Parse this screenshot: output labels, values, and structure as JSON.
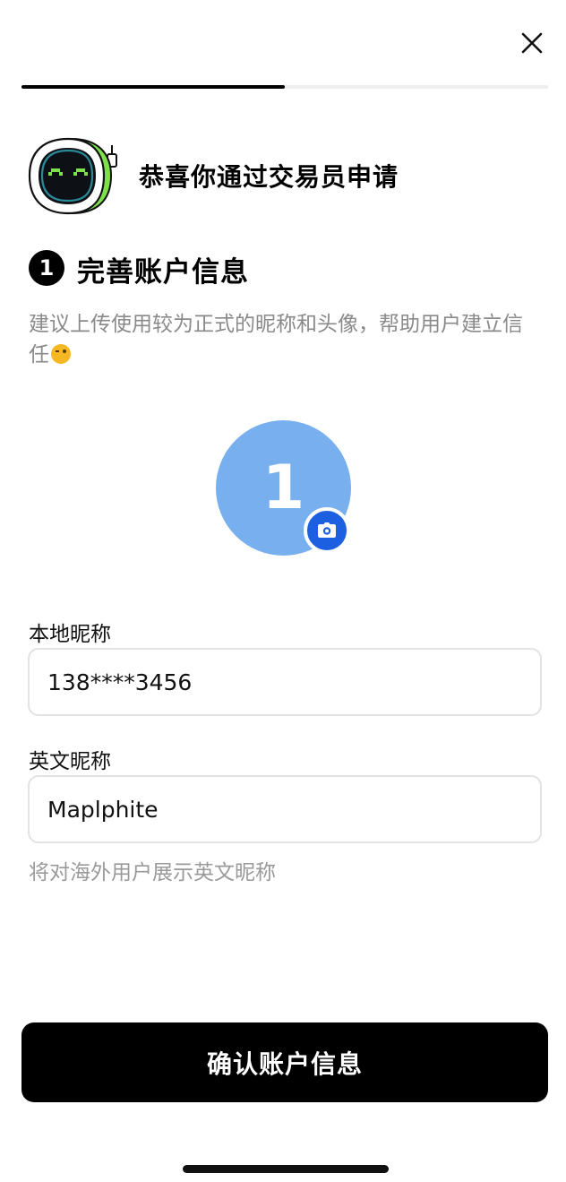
{
  "header": {
    "close_icon": "close-icon",
    "progress": 0.5
  },
  "intro": {
    "mascot_icon": "robot-mascot-icon",
    "congrats_text": "恭喜你通过交易员申请"
  },
  "step": {
    "number": "1",
    "title": "完善账户信息",
    "hint": "建议上传使用较为正式的昵称和头像，帮助用户建立信任"
  },
  "avatar": {
    "initial": "1",
    "camera_icon": "camera-icon"
  },
  "form": {
    "local_nickname_label": "本地昵称",
    "local_nickname_value": "138****3456",
    "english_nickname_label": "英文昵称",
    "english_nickname_value": "Maplphite",
    "english_nickname_hint": "将对海外用户展示英文昵称"
  },
  "footer": {
    "confirm_label": "确认账户信息"
  },
  "colors": {
    "accent_blue": "#1c5fe0",
    "avatar_bg": "#78afef",
    "mascot_green": "#7ee04a",
    "button_bg": "#000000"
  }
}
